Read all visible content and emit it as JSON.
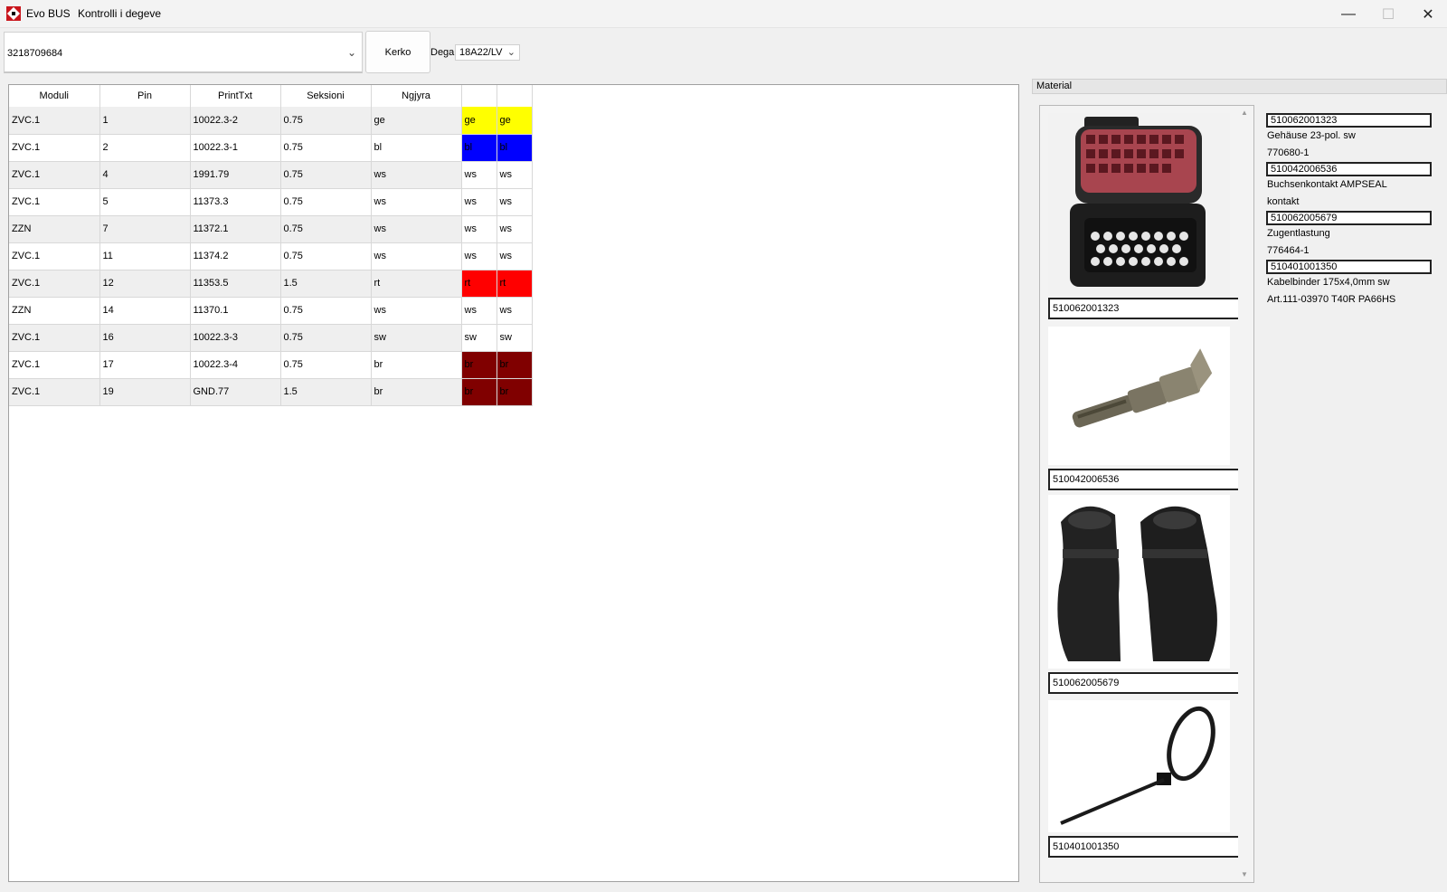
{
  "window": {
    "app_name": "Evo BUS",
    "title": "Kontrolli i degeve"
  },
  "toolbar": {
    "search_value": "3218709684",
    "search_button": "Kerko",
    "dega_label": "Dega",
    "dega_value": "18A22/LV"
  },
  "grid": {
    "columns": [
      "Moduli",
      "Pin",
      "PrintTxt",
      "Seksioni",
      "Ngjyra",
      "",
      ""
    ],
    "rows": [
      {
        "moduli": "ZVC.1",
        "pin": "1",
        "printtxt": "10022.3-2",
        "seksioni": "0.75",
        "ngjyra": "ge",
        "c1": "ge",
        "c2": "ge"
      },
      {
        "moduli": "ZVC.1",
        "pin": "2",
        "printtxt": "10022.3-1",
        "seksioni": "0.75",
        "ngjyra": "bl",
        "c1": "bl",
        "c2": "bl"
      },
      {
        "moduli": "ZVC.1",
        "pin": "4",
        "printtxt": "1991.79",
        "seksioni": "0.75",
        "ngjyra": "ws",
        "c1": "ws",
        "c2": "ws"
      },
      {
        "moduli": "ZVC.1",
        "pin": "5",
        "printtxt": "11373.3",
        "seksioni": "0.75",
        "ngjyra": "ws",
        "c1": "ws",
        "c2": "ws"
      },
      {
        "moduli": "ZZN",
        "pin": "7",
        "printtxt": "11372.1",
        "seksioni": "0.75",
        "ngjyra": "ws",
        "c1": "ws",
        "c2": "ws"
      },
      {
        "moduli": "ZVC.1",
        "pin": "11",
        "printtxt": "11374.2",
        "seksioni": "0.75",
        "ngjyra": "ws",
        "c1": "ws",
        "c2": "ws"
      },
      {
        "moduli": "ZVC.1",
        "pin": "12",
        "printtxt": "11353.5",
        "seksioni": "1.5",
        "ngjyra": "rt",
        "c1": "rt",
        "c2": "rt"
      },
      {
        "moduli": "ZZN",
        "pin": "14",
        "printtxt": "11370.1",
        "seksioni": "0.75",
        "ngjyra": "ws",
        "c1": "ws",
        "c2": "ws"
      },
      {
        "moduli": "ZVC.1",
        "pin": "16",
        "printtxt": "10022.3-3",
        "seksioni": "0.75",
        "ngjyra": "sw",
        "c1": "sw",
        "c2": "sw"
      },
      {
        "moduli": "ZVC.1",
        "pin": "17",
        "printtxt": "10022.3-4",
        "seksioni": "0.75",
        "ngjyra": "br",
        "c1": "br",
        "c2": "br"
      },
      {
        "moduli": "ZVC.1",
        "pin": "19",
        "printtxt": "GND.77",
        "seksioni": "1.5",
        "ngjyra": "br",
        "c1": "br",
        "c2": "br"
      }
    ],
    "wire_colors": {
      "ge": "#ffff00",
      "bl": "#0000ff",
      "rt": "#ff0000",
      "br": "#800000",
      "ws": "#ffffff",
      "sw": "#ffffff"
    }
  },
  "material": {
    "header": "Material",
    "items": [
      {
        "code": "510062001323",
        "icon": "connector-housing-image"
      },
      {
        "code": "510042006536",
        "icon": "contact-pin-image"
      },
      {
        "code": "510062005679",
        "icon": "strain-relief-image"
      },
      {
        "code": "510401001350",
        "icon": "cable-tie-image"
      }
    ],
    "details": [
      {
        "code": "510062001323",
        "lines": [
          "Gehäuse 23-pol. sw",
          "770680-1"
        ]
      },
      {
        "code": "510042006536",
        "lines": [
          "Buchsenkontakt AMPSEAL",
          "kontakt"
        ]
      },
      {
        "code": "510062005679",
        "lines": [
          "Zugentlastung",
          "776464-1"
        ]
      },
      {
        "code": "510401001350",
        "lines": [
          "Kabelbinder 175x4,0mm  sw",
          "Art.111-03970  T40R PA66HS"
        ]
      }
    ]
  }
}
